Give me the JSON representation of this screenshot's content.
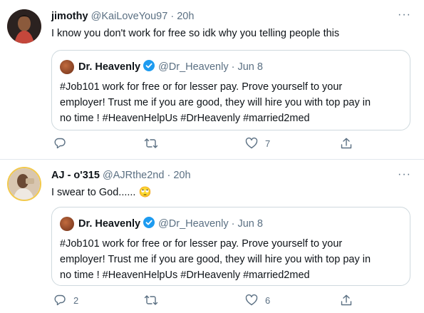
{
  "tweets": [
    {
      "name": "jimothy",
      "handle": "@KaiLoveYou97",
      "sep": "·",
      "time": "20h",
      "text": "I know you don't work for free so idk why you telling people this",
      "emoji": "",
      "quote": {
        "name": "Dr. Heavenly",
        "handle": "@Dr_Heavenly",
        "sep": "·",
        "date": "Jun 8",
        "line1": "#Job101  work for free or for lesser pay. Prove yourself to your",
        "line2": "employer!   Trust me if you are good, they will hire you with top pay in",
        "line3": "no time ! #HeavenHelpUs #DrHeavenly #married2med"
      },
      "replies": "",
      "retweets": "",
      "likes": "7"
    },
    {
      "name": "AJ - o'315",
      "handle": "@AJRthe2nd",
      "sep": "·",
      "time": "20h",
      "text": "I swear to God......",
      "emoji": "🙄",
      "quote": {
        "name": "Dr. Heavenly",
        "handle": "@Dr_Heavenly",
        "sep": "·",
        "date": "Jun 8",
        "line1": "#Job101  work for free or for lesser pay. Prove yourself to your",
        "line2": "employer!   Trust me if you are good, they will hire you with top pay in",
        "line3": "no time ! #HeavenHelpUs #DrHeavenly #married2med"
      },
      "replies": "2",
      "retweets": "",
      "likes": "6"
    }
  ],
  "more_icon": "···",
  "colors": {
    "secondary_text": "#5b7083",
    "border": "#cfd9de",
    "verified": "#1d9bf0"
  }
}
